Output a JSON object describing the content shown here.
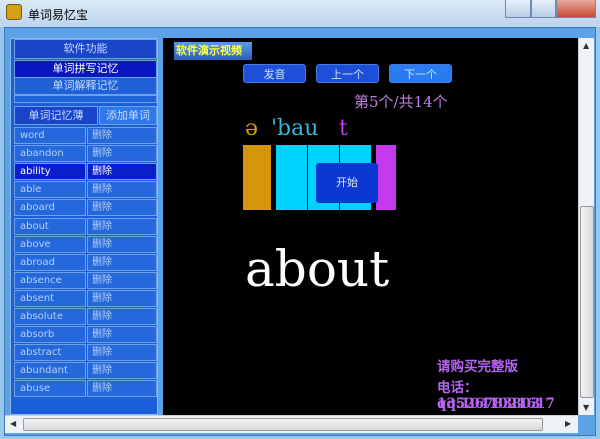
{
  "window": {
    "title": "单词易忆宝"
  },
  "sidebar": {
    "function_header": "软件功能",
    "spell_memory": "单词拼写记忆",
    "meaning_memory": "单词解释记忆",
    "tab_wordbook": "单词记忆薄",
    "tab_add_word": "添加单词",
    "rows": [
      {
        "word": "word",
        "action": "删除"
      },
      {
        "word": "abandon",
        "action": "删除"
      },
      {
        "word": "ability",
        "action": "删除",
        "selected": true
      },
      {
        "word": "able",
        "action": "删除"
      },
      {
        "word": "aboard",
        "action": "删除"
      },
      {
        "word": "about",
        "action": "删除"
      },
      {
        "word": "above",
        "action": "删除"
      },
      {
        "word": "abroad",
        "action": "删除"
      },
      {
        "word": "absence",
        "action": "删除"
      },
      {
        "word": "absent",
        "action": "删除"
      },
      {
        "word": "absolute",
        "action": "删除"
      },
      {
        "word": "absorb",
        "action": "删除"
      },
      {
        "word": "abstract",
        "action": "删除"
      },
      {
        "word": "abundant",
        "action": "删除"
      },
      {
        "word": "abuse",
        "action": "删除"
      }
    ]
  },
  "main": {
    "demo_video": "软件演示视频",
    "pronounce": "发音",
    "prev": "上一个",
    "next": "下一个",
    "counter": "第5个/共14个",
    "phonetic": [
      "ə",
      "'bau",
      "t"
    ],
    "start": "开始",
    "word": "about",
    "promo": [
      "请购买完整版",
      "电话：13526783803",
      "qq:1041021617"
    ]
  },
  "colors": {
    "orange": "#d4960a",
    "cyan": "#00d2ff",
    "purple": "#c43af0"
  }
}
